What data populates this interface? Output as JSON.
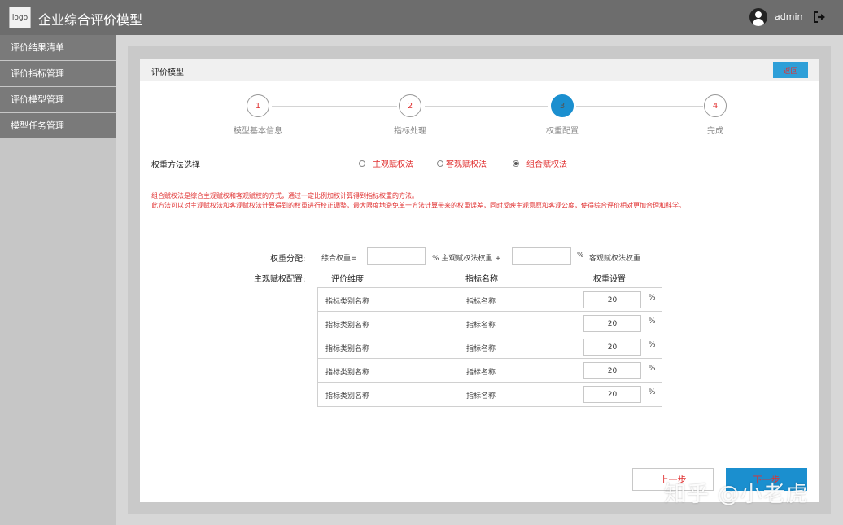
{
  "header": {
    "logo_text": "logo",
    "title": "企业综合评价模型",
    "username": "admin",
    "user_icon": "user-avatar-icon",
    "logout_icon": "logout-icon"
  },
  "sidebar": {
    "items": [
      {
        "label": "评价结果清单"
      },
      {
        "label": "评价指标管理"
      },
      {
        "label": "评价模型管理"
      },
      {
        "label": "模型任务管理"
      }
    ]
  },
  "panel": {
    "title": "评价模型",
    "back_label": "返回"
  },
  "steps": [
    {
      "num": "1",
      "label": "模型基本信息",
      "active": false
    },
    {
      "num": "2",
      "label": "指标处理",
      "active": false
    },
    {
      "num": "3",
      "label": "权重配置",
      "active": true
    },
    {
      "num": "4",
      "label": "完成",
      "active": false
    }
  ],
  "method": {
    "label": "权重方法选择",
    "options": [
      {
        "label": "主观赋权法",
        "checked": false
      },
      {
        "label": "客观赋权法",
        "checked": false
      },
      {
        "label": "组合赋权法",
        "checked": true
      }
    ],
    "description": [
      "组合赋权法是综合主观赋权和客观赋权的方式，通过一定比例加权计算得到指标权重的方法。",
      "此方法可以对主观赋权法和客观赋权法计算得到的权重进行校正调整，最大限度地避免单一方法计算带来的权重误差，同时反映主观意愿和客观公度，使得综合评价相对更加合理和科学。"
    ]
  },
  "allocation": {
    "label": "权重分配:",
    "combined_label": "综合权重=",
    "combined_value": "",
    "subjective_suffix": "% 主观赋权法权重 +",
    "objective_value": "",
    "objective_suffix_pct": "%",
    "objective_suffix": "客观赋权法权重"
  },
  "subjective": {
    "label": "主观赋权配置:",
    "columns": {
      "dimension": "评价维度",
      "indicator": "指标名称",
      "weight": "权重设置"
    },
    "rows": [
      {
        "dimension": "指标类别名称",
        "indicator": "指标名称",
        "weight": "20",
        "unit": "%"
      },
      {
        "dimension": "指标类别名称",
        "indicator": "指标名称",
        "weight": "20",
        "unit": "%"
      },
      {
        "dimension": "指标类别名称",
        "indicator": "指标名称",
        "weight": "20",
        "unit": "%"
      },
      {
        "dimension": "指标类别名称",
        "indicator": "指标名称",
        "weight": "20",
        "unit": "%"
      },
      {
        "dimension": "指标类别名称",
        "indicator": "指标名称",
        "weight": "20",
        "unit": "%"
      }
    ]
  },
  "actions": {
    "prev_label": "上一步",
    "next_label": "下一步"
  },
  "watermark": "知乎 @小老虎",
  "colors": {
    "accent": "#1b8fcf",
    "warning_text": "#e03030",
    "header_bg": "#6d6d6d",
    "sidebar_item_bg": "#7a7a7a"
  }
}
